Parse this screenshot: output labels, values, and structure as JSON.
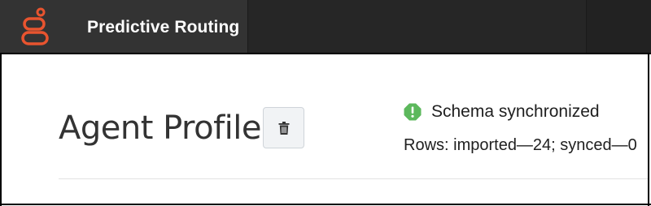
{
  "app": {
    "title": "Predictive Routing"
  },
  "header": {
    "page_title": "Agent Profile",
    "delete_button_icon": "trash-icon"
  },
  "status": {
    "icon": "alert-octagon-icon",
    "icon_color": "#5cb85c",
    "text": "Schema synchronized",
    "rows_text": "Rows: imported—24; synced—0"
  },
  "colors": {
    "topbar": "#262626",
    "brand_block": "#333333",
    "logo": "#e8542f",
    "title_text": "#333333"
  }
}
